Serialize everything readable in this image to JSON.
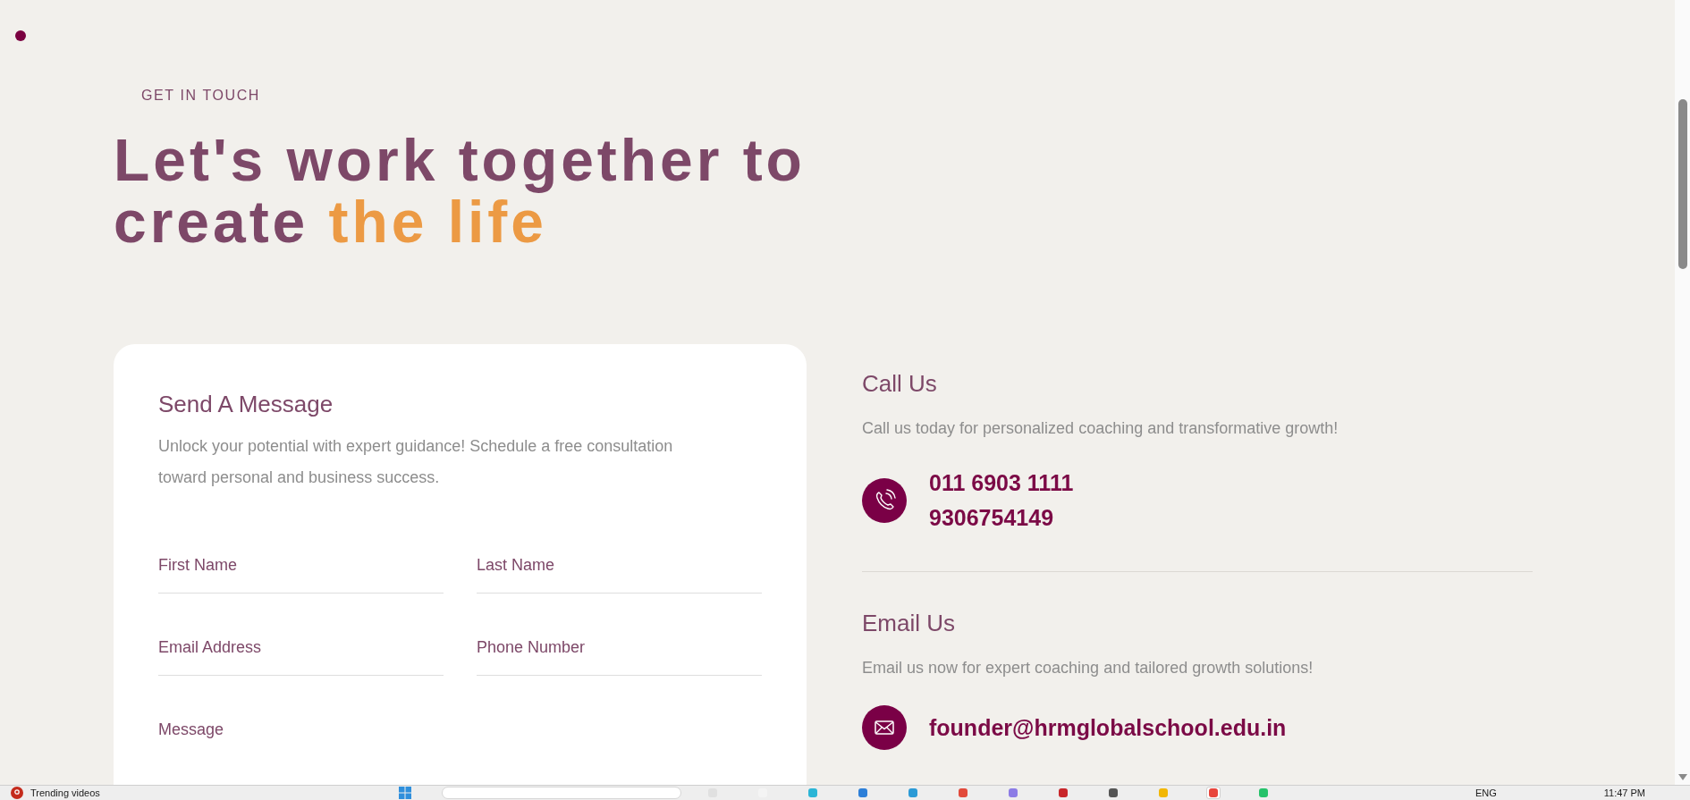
{
  "header": {
    "eyebrow": "GET IN TOUCH",
    "title_parts": [
      {
        "text": "Let's work together to create",
        "highlight": false
      },
      {
        "text": "the life",
        "highlight": true
      }
    ]
  },
  "message_form": {
    "title": "Send A Message",
    "description": "Unlock your potential with expert guidance! Schedule a free consultation toward personal and business success.",
    "fields": [
      {
        "kind": "line",
        "placeholder": "First Name"
      },
      {
        "kind": "line",
        "placeholder": "Last Name"
      },
      {
        "kind": "line",
        "placeholder": "Email Address"
      },
      {
        "kind": "line",
        "placeholder": "Phone Number"
      },
      {
        "kind": "multiline",
        "placeholder": "Message"
      }
    ]
  },
  "contact": [
    {
      "kind": "phone",
      "title": "Call Us",
      "description": "Call us today for personalized coaching and transformative growth!",
      "lines": [
        "011 6903 1111",
        "9306754149"
      ]
    },
    {
      "kind": "email",
      "title": "Email Us",
      "description": "Email us now for expert coaching and tailored growth solutions!",
      "lines": [
        "founder@hrmglobalschool.edu.in"
      ]
    }
  ],
  "taskbar": {
    "news": "Trending videos",
    "apps": [
      {
        "selected": false
      },
      {
        "selected": false
      },
      {
        "selected": false
      },
      {
        "selected": false
      },
      {
        "selected": false
      },
      {
        "selected": false
      },
      {
        "selected": false
      },
      {
        "selected": false
      },
      {
        "selected": false
      },
      {
        "selected": false
      },
      {
        "selected": true
      },
      {
        "selected": false
      }
    ],
    "language": "ENG",
    "clock": "11:47 PM"
  }
}
